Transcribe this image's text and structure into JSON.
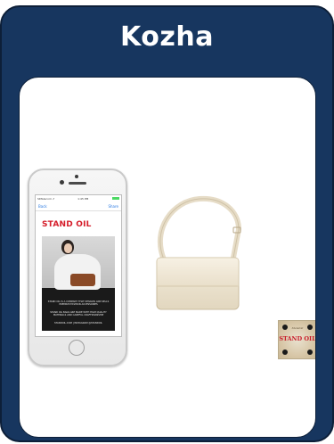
{
  "card": {
    "title": "Kozha"
  },
  "phone": {
    "status_left": "SKTelecom ⇗",
    "status_center": "1:45 PM",
    "nav_back": "Back",
    "nav_right": "Share",
    "brand": "STAND OIL",
    "ad_line1": "STAND OIL IS A COMPANY THAT DESIGNS AND SELLS PREMIUM FASHION ACCESSORIES",
    "ad_line2": "STAND OIL BAGS ARE MADE WITH HIGH QUALITY MATERIALS AND CAREFUL CRAFTSMANSHIP",
    "ad_line3": "STANDOIL.COM | INSTAGRAM @STANDOIL"
  },
  "label": {
    "script": "Standoil",
    "text": "STAND OIL"
  },
  "colors": {
    "card_bg": "#17365f",
    "brand_red": "#d51d2a",
    "bag_cream": "#ece4d2"
  },
  "icons": [
    "phone-image",
    "handbag-image",
    "brand-label-image"
  ]
}
